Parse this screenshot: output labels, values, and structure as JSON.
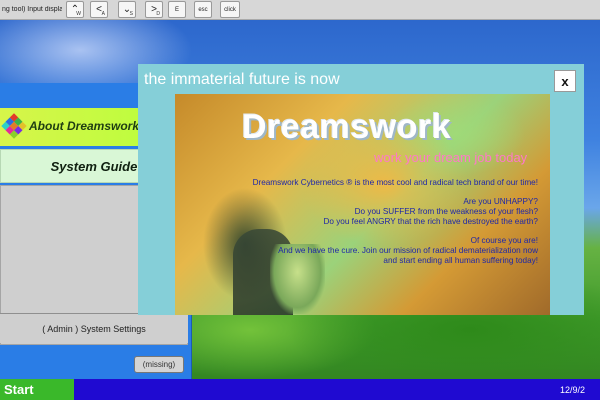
{
  "input_bar": {
    "title": "ng tool) Input displayer",
    "keys": [
      {
        "arrow": "⌃",
        "sub": "W"
      },
      {
        "arrow": "<",
        "sub": "A"
      },
      {
        "arrow": "⌄",
        "sub": "S"
      },
      {
        "arrow": ">",
        "sub": "D"
      }
    ],
    "extra_keys": [
      "E",
      "esc",
      "click"
    ]
  },
  "left_window": {
    "about_title": "About Dreamswork",
    "system_guide": "System Guide",
    "admin_settings": "( Admin ) System Settings",
    "missing_button": "(missing)"
  },
  "popup": {
    "tagline": "the immaterial future is now",
    "close_label": "x",
    "logo_text": "Dreamswork",
    "slogan": "work your dream job today",
    "paragraphs": [
      [
        "Dreamswork Cybernetics ® is the most cool and radical tech brand of our time!"
      ],
      [
        "Are you UNHAPPY?",
        "Do you SUFFER from the weakness of your flesh?",
        "Do you feel ANGRY that the rich have destroyed the earth?"
      ],
      [
        "Of course you are!",
        "And we have the cure. Join our mission of radical dematerialization now",
        "and start ending all human suffering today!"
      ]
    ]
  },
  "taskbar": {
    "start_label": "Start",
    "clock": "12/9/2"
  },
  "colors": {
    "taskbar": "#1f0ad1",
    "start": "#3ab82a",
    "about_header": "#c8f542",
    "popup_bg": "#85cfd8",
    "slogan": "#ff78c8",
    "body_text": "#1e27a8"
  }
}
